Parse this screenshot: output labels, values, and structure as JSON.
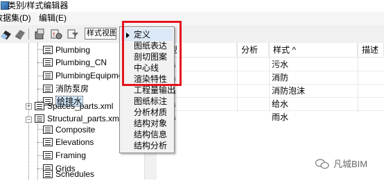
{
  "window": {
    "title": "类别/样式编辑器"
  },
  "menubar": {
    "items": [
      "数据集(D)",
      "编辑(E)"
    ]
  },
  "toolbar": {
    "view_dropdown": "样式视图"
  },
  "tree": {
    "nodes": [
      {
        "label": "Plumbing"
      },
      {
        "label": "Plumbing_CN"
      },
      {
        "label": "PlumbingEquipmen"
      },
      {
        "label": "消防泵房"
      },
      {
        "label": "给排水"
      },
      {
        "label": "Spaces_parts.xml"
      },
      {
        "label": "Structural_parts.xml"
      },
      {
        "label": "Composite"
      },
      {
        "label": "Elevations"
      },
      {
        "label": "Framing"
      },
      {
        "label": "Grids"
      },
      {
        "label": "Schedules"
      }
    ],
    "expander_plus": "+",
    "expander_minus": "−"
  },
  "grid": {
    "columns": [
      "类型",
      "分析",
      "样式 ^",
      "描述"
    ],
    "rows": [
      {
        "type": "orma",
        "style": "污水"
      },
      {
        "type": "orma",
        "style": "消防"
      },
      {
        "type": "orma",
        "style": "消防泡沫"
      },
      {
        "type": "orma",
        "style": "给水"
      },
      {
        "type": "orma",
        "style": "雨水"
      }
    ]
  },
  "context_menu": {
    "items": [
      "定义",
      "图纸表达",
      "剖切图案",
      "中心线",
      "渲染特性",
      "工程量输出",
      "图纸标注",
      "分析材质",
      "结构对象",
      "结构信息",
      "结构分析"
    ]
  },
  "watermark": {
    "text": "凡城BIM"
  },
  "colors": {
    "highlight_box": "#e5131f",
    "menu_bg": "#f2f2f2",
    "selection": "#cfe4f7"
  }
}
